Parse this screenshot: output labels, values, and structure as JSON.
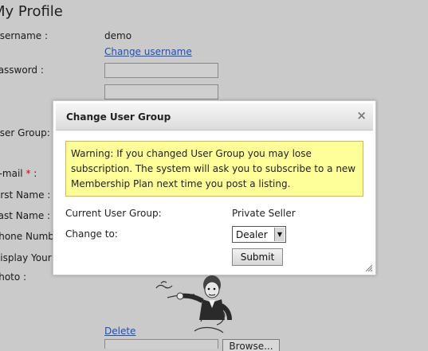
{
  "page": {
    "title": "My Profile",
    "username_label": "Username :",
    "username_value": "demo",
    "change_username_link": "Change username",
    "password_label": "Password :",
    "user_group_label": "User Group:",
    "email_label": "E-mail ",
    "email_required": "*",
    "email_colon": " :",
    "first_name_label": "First Name :",
    "last_name_label": "Last Name :",
    "phone_label": "Phone Number",
    "display_label": "Display Your",
    "photo_label": "Photo :",
    "delete_link": "Delete",
    "browse_button": "Browse..."
  },
  "modal": {
    "title": "Change User Group",
    "close_icon": "close-icon",
    "warning_line1": "Warning: If you changed User Group you may lose",
    "warning_line2": "subscription. The system will ask you to subscribe to a new",
    "warning_line3": "Membership Plan next time you post a listing.",
    "current_group_label": "Current User Group:",
    "current_group_value": "Private Seller",
    "change_to_label": "Change to:",
    "change_to_selected": "Dealer",
    "submit_label": "Submit",
    "colors": {
      "warning_bg": "#ffff99",
      "warning_border": "#d9b54a",
      "link": "#1d4fb8"
    }
  }
}
